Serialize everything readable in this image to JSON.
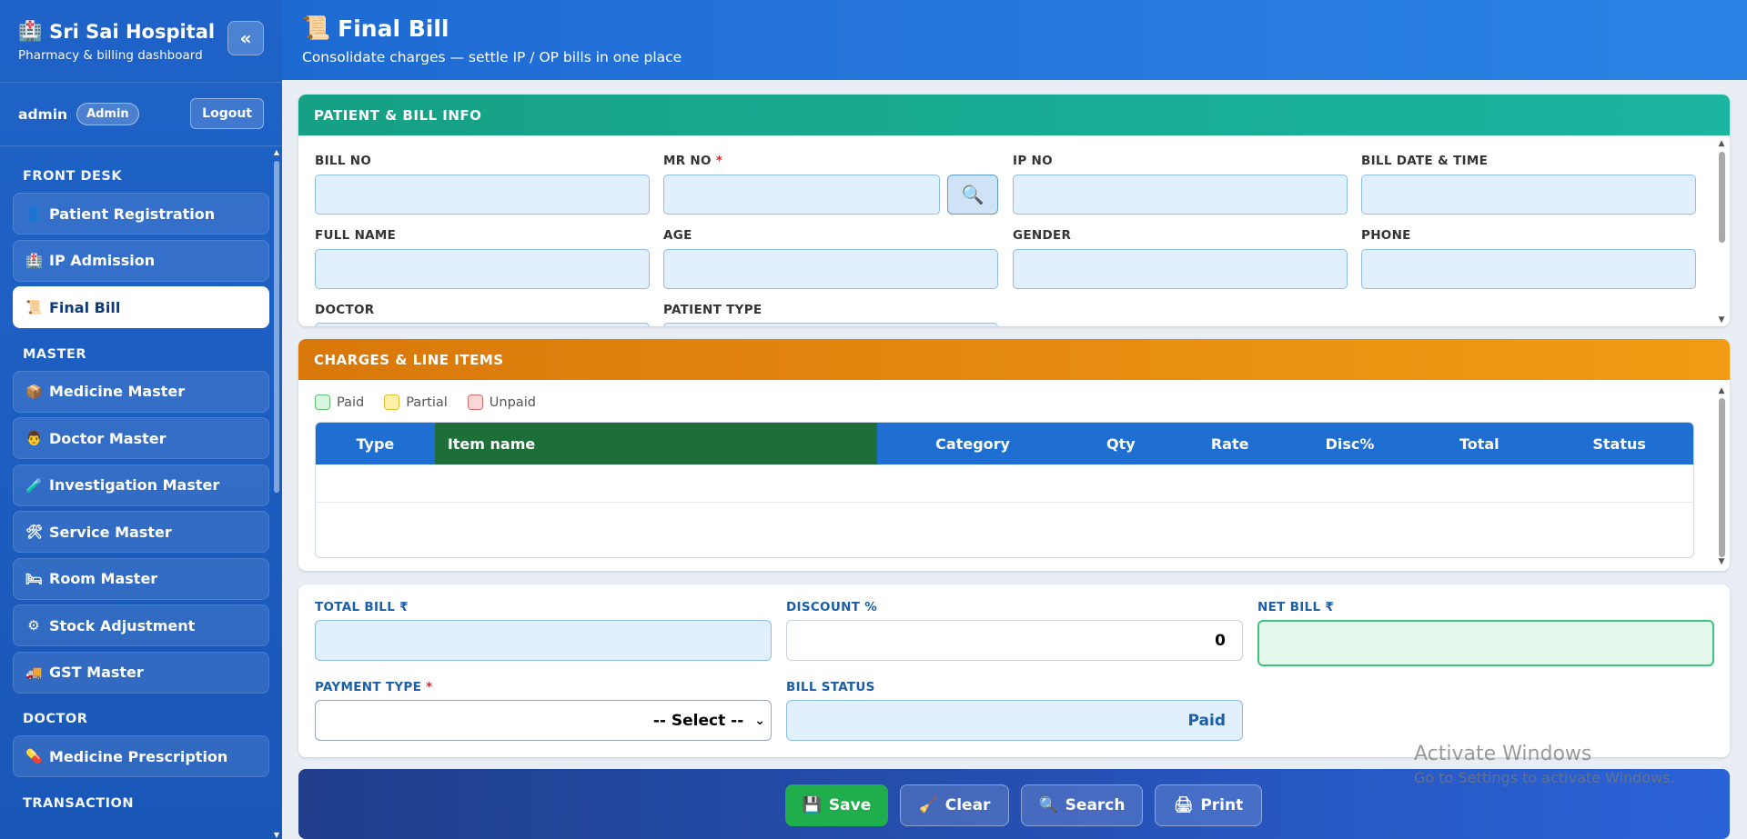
{
  "sidebar": {
    "brand_title": "Sri Sai Hospital",
    "brand_sub": "Pharmacy & billing dashboard",
    "collapse": "«",
    "username": "admin",
    "role": "Admin",
    "logout": "Logout",
    "sections": [
      {
        "title": "FRONT DESK",
        "items": [
          {
            "label": "Patient Registration",
            "icon": "👤"
          },
          {
            "label": "IP Admission",
            "icon": "🏥"
          },
          {
            "label": "Final Bill",
            "icon": "📜",
            "active": true
          }
        ]
      },
      {
        "title": "MASTER",
        "items": [
          {
            "label": "Medicine Master",
            "icon": "📦"
          },
          {
            "label": "Doctor Master",
            "icon": "👨"
          },
          {
            "label": "Investigation Master",
            "icon": "🧪"
          },
          {
            "label": "Service Master",
            "icon": "🛠"
          },
          {
            "label": "Room Master",
            "icon": "🛏"
          },
          {
            "label": "Stock Adjustment",
            "icon": "⚙"
          },
          {
            "label": "GST Master",
            "icon": "🚚"
          }
        ]
      },
      {
        "title": "DOCTOR",
        "items": [
          {
            "label": "Medicine Prescription",
            "icon": "💊"
          }
        ]
      },
      {
        "title": "TRANSACTION",
        "items": []
      }
    ]
  },
  "header": {
    "title": "Final Bill",
    "subtitle": "Consolidate charges — settle IP / OP bills in one place"
  },
  "patient_card": {
    "title": "PATIENT & BILL INFO",
    "bill_no": "BILL NO",
    "mr_no": "MR NO",
    "ip_no": "IP NO",
    "bill_date": "BILL DATE & TIME",
    "full_name": "FULL NAME",
    "age": "AGE",
    "gender": "GENDER",
    "phone": "PHONE",
    "doctor": "DOCTOR",
    "patient_type": "PATIENT TYPE"
  },
  "charges_card": {
    "title": "CHARGES & LINE ITEMS",
    "legend": {
      "paid": "Paid",
      "partial": "Partial",
      "unpaid": "Unpaid"
    },
    "columns": [
      "Type",
      "Item name",
      "Category",
      "Qty",
      "Rate",
      "Disc%",
      "Total",
      "Status"
    ]
  },
  "totals": {
    "total_bill": "TOTAL BILL ₹",
    "discount": "DISCOUNT %",
    "discount_value": "0",
    "net_bill": "NET BILL ₹",
    "payment_type": "PAYMENT TYPE",
    "payment_value": "-- Select --",
    "bill_status": "BILL STATUS",
    "bill_status_value": "Paid"
  },
  "actions": {
    "save": "Save",
    "clear": "Clear",
    "search": "Search",
    "print": "Print"
  },
  "watermark": {
    "line1": "Activate Windows",
    "line2": "Go to Settings to activate Windows."
  },
  "colors": {
    "sidebar": "#1f63c8",
    "teal": "#16a085",
    "orange": "#f29c15",
    "table_header": "#1f6fd3",
    "save": "#1fae4b"
  }
}
